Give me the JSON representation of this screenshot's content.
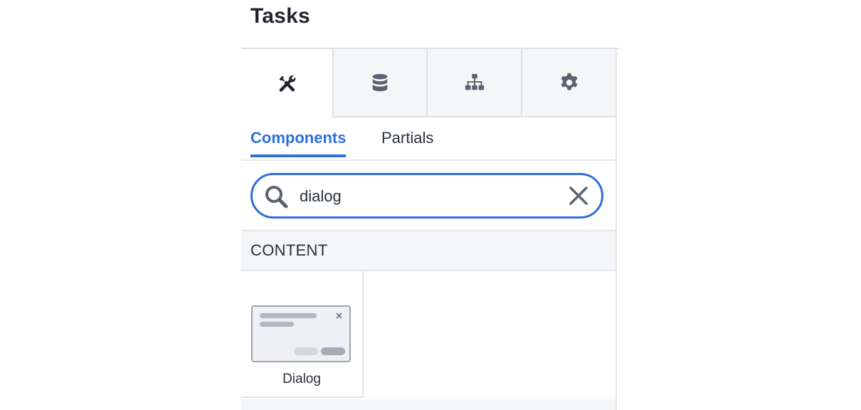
{
  "panel": {
    "title": "Tasks"
  },
  "icon_tabs": [
    {
      "icon": "wrench-screwdriver-icon",
      "active": true
    },
    {
      "icon": "database-icon",
      "active": false
    },
    {
      "icon": "sitemap-icon",
      "active": false
    },
    {
      "icon": "gear-icon",
      "active": false
    }
  ],
  "text_tabs": [
    {
      "label": "Components",
      "active": true
    },
    {
      "label": "Partials",
      "active": false
    }
  ],
  "search": {
    "value": "dialog",
    "placeholder": ""
  },
  "section": {
    "label": "CONTENT"
  },
  "components": [
    {
      "label": "Dialog",
      "icon": "dialog-thumbnail-icon"
    }
  ],
  "colors": {
    "accent": "#2e6fdc",
    "text": "#1f2430",
    "muted_icon": "#5d6270",
    "border": "#e3e5ea",
    "tab_bg": "#f5f6f8"
  }
}
